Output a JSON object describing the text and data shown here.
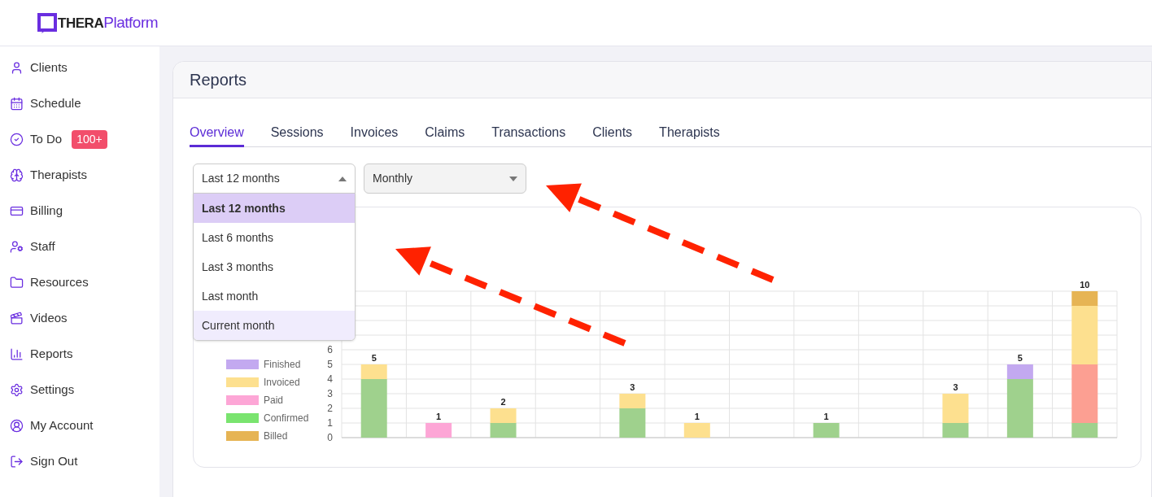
{
  "logo": {
    "strong": "THERA",
    "light": "Platform"
  },
  "sidebar": {
    "items": [
      {
        "label": "Clients",
        "selected": false
      },
      {
        "label": "Schedule",
        "selected": false
      },
      {
        "label": "To Do",
        "badge": "100+",
        "selected": false
      },
      {
        "label": "Therapists",
        "selected": false
      },
      {
        "label": "Billing",
        "selected": false
      },
      {
        "label": "Staff",
        "selected": false
      },
      {
        "label": "Resources",
        "selected": false
      },
      {
        "label": "Videos",
        "selected": false
      },
      {
        "label": "Reports",
        "selected": false
      },
      {
        "label": "Settings",
        "selected": false
      },
      {
        "label": "My Account",
        "selected": false
      },
      {
        "label": "Sign Out",
        "selected": false
      }
    ]
  },
  "page": {
    "title": "Reports"
  },
  "tabs": [
    {
      "label": "Overview",
      "selected": true
    },
    {
      "label": "Sessions",
      "selected": false
    },
    {
      "label": "Invoices",
      "selected": false
    },
    {
      "label": "Claims",
      "selected": false
    },
    {
      "label": "Transactions",
      "selected": false
    },
    {
      "label": "Clients",
      "selected": false
    },
    {
      "label": "Therapists",
      "selected": false
    }
  ],
  "filters": {
    "range": {
      "value": "Last 12 months",
      "expanded": true,
      "options": [
        {
          "label": "Last 12 months",
          "selected": true,
          "hovered": false
        },
        {
          "label": "Last 6 months",
          "selected": false,
          "hovered": false
        },
        {
          "label": "Last 3 months",
          "selected": false,
          "hovered": false
        },
        {
          "label": "Last month",
          "selected": false,
          "hovered": false
        },
        {
          "label": "Current month",
          "selected": false,
          "hovered": true
        }
      ]
    },
    "interval": {
      "value": "Monthly",
      "expanded": false
    }
  },
  "chart": {
    "chart_data": {
      "type": "bar",
      "stacked": true,
      "grid": true,
      "ylim": [
        0,
        10
      ],
      "yticks": [
        0,
        1,
        2,
        3,
        4,
        5,
        6
      ],
      "value_labels": [
        "5",
        "1",
        "2",
        null,
        "3",
        "1",
        null,
        "1",
        null,
        "3",
        "5",
        "10"
      ],
      "series": [
        {
          "color": "#9fd18d",
          "values": [
            4,
            0,
            1,
            0,
            2,
            0,
            0,
            1,
            0,
            1,
            4,
            1
          ]
        },
        {
          "color": "#fc9f92",
          "values": [
            0,
            0,
            0,
            0,
            0,
            0,
            0,
            0,
            0,
            0,
            0,
            4
          ]
        },
        {
          "name": "Finished",
          "color": "#c3a9f0",
          "values": [
            0,
            0,
            0,
            0,
            0,
            0,
            0,
            0,
            0,
            0,
            1,
            0
          ]
        },
        {
          "name": "Invoiced",
          "color": "#fde08f",
          "values": [
            1,
            0,
            1,
            0,
            1,
            1,
            0,
            0,
            0,
            2,
            0,
            4
          ]
        },
        {
          "name": "Paid",
          "color": "#fda6d6",
          "values": [
            0,
            1,
            0,
            0,
            0,
            0,
            0,
            0,
            0,
            0,
            0,
            0
          ]
        },
        {
          "name": "Confirmed",
          "color": "#7ae46f",
          "values": [
            0,
            0,
            0,
            0,
            0,
            0,
            0,
            0,
            0,
            0,
            0,
            0
          ]
        },
        {
          "name": "Billed",
          "color": "#e6b454",
          "values": [
            0,
            0,
            0,
            0,
            0,
            0,
            0,
            0,
            0,
            0,
            0,
            1
          ]
        }
      ]
    }
  }
}
